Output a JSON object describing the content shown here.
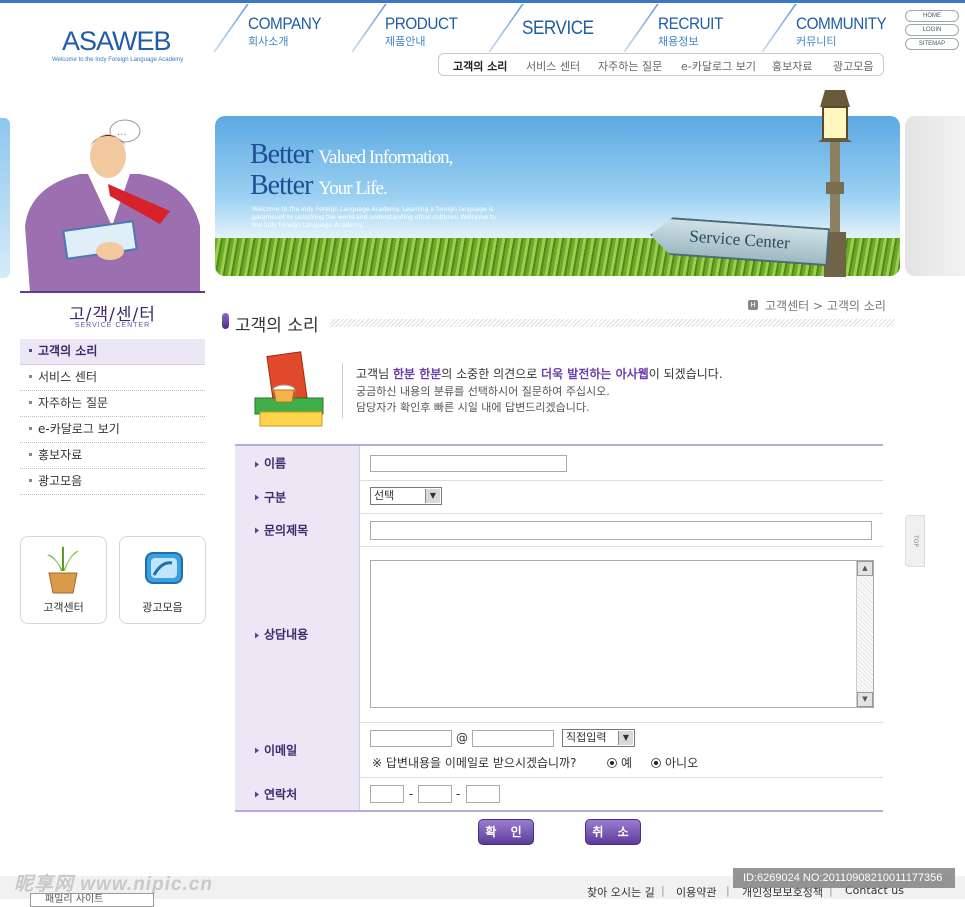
{
  "header": {
    "logo": "ASAWEB",
    "logo_sub": "Welcome to the Indy Foreign Language Academy",
    "gnav": [
      {
        "en": "COMPANY",
        "ko": "회사소개"
      },
      {
        "en": "PRODUCT",
        "ko": "제품안내"
      },
      {
        "en": "SERVICE",
        "ko": ""
      },
      {
        "en": "RECRUIT",
        "ko": "채용정보"
      },
      {
        "en": "COMMUNITY",
        "ko": "커뮤니티"
      }
    ],
    "util": [
      "HOME",
      "LOGIN",
      "SITEMAP"
    ],
    "subnav": [
      "고객의 소리",
      "서비스 센터",
      "자주하는 질문",
      "e-카달로그 보기",
      "홍보자료",
      "광고모음"
    ]
  },
  "banner": {
    "line1_strong": "Better",
    "line1_rest": "Valued Information,",
    "line2_strong": "Better",
    "line2_rest": "Your Life.",
    "small": "Welcome to the Indy Foreign Language Academy. Learning a foreign language is paramount to unlocking the world and understanding other cultures. Welcome to the Indy Foreign Language Academy.",
    "sign": "Service Center"
  },
  "left": {
    "title": "고/객/센/터",
    "title_en": "SERVICE CENTER",
    "nav": [
      "고객의 소리",
      "서비스 센터",
      "자주하는 질문",
      "e-카달로그 보기",
      "홍보자료",
      "광고모음"
    ],
    "quick": [
      "고객센터",
      "광고모음"
    ]
  },
  "page": {
    "title": "고객의 소리",
    "breadcrumb": "고객센터 > 고객의 소리",
    "intro1_a": "고객님 ",
    "intro1_b": "한분 한분",
    "intro1_c": "의 소중한 의견으로 ",
    "intro1_d": "더욱 발전하는 아사웹",
    "intro1_e": "이 되겠습니다.",
    "intro2": "궁금하신 내용의 분류를 선택하시어 질문하여 주십시오.",
    "intro3": "담당자가 확인후 빠른 시일 내에 답변드리겠습니다."
  },
  "form": {
    "labels": {
      "name": "이름",
      "category": "구분",
      "subject": "문의제목",
      "content": "상담내용",
      "email": "이메일",
      "phone": "연락처"
    },
    "category_value": "선택",
    "email_at": "@",
    "email_domain_value": "직접입력",
    "email_question": "※ 답변내용을 이메일로 받으시겠습니까?",
    "yes": "예",
    "no": "아니오",
    "phone_dash": "-"
  },
  "buttons": {
    "confirm": "확 인",
    "cancel": "취 소"
  },
  "side_top": "TOP",
  "footer": {
    "links": [
      "찾아 오시는 길",
      "이용약관",
      "개인정보보호정책",
      "Contact us"
    ],
    "family": "패밀리 사이트",
    "watermark": "昵享网 www.nipic.cn",
    "image_id": "ID:6269024 NO:20110908210011177356"
  }
}
